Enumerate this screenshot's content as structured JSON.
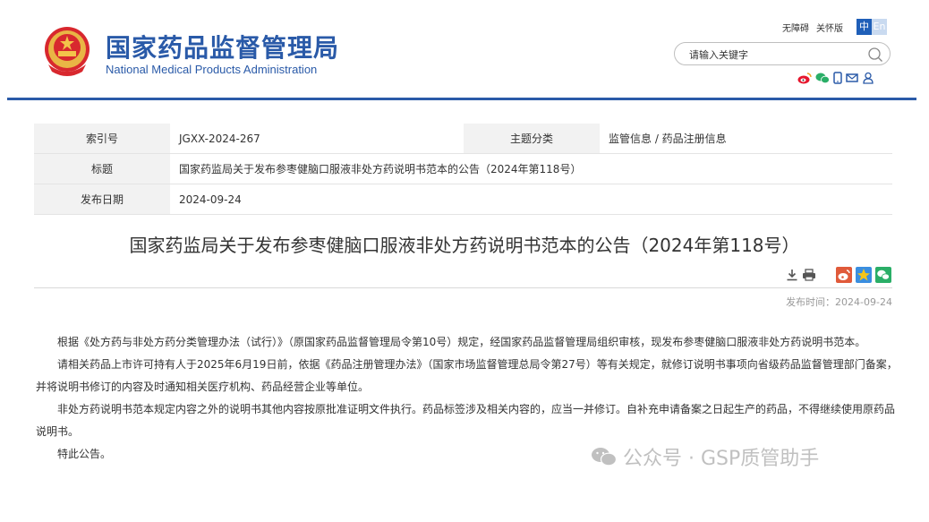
{
  "header": {
    "site_name_cn": "国家药品监督管理局",
    "site_name_en": "National Medical Products Administration",
    "accessibility_link": "无障碍",
    "care_mode_link": "关怀版",
    "lang_zh": "中",
    "lang_en": "En",
    "search_placeholder": "请输入关键字"
  },
  "meta": {
    "index_label": "索引号",
    "index_value": "JGXX-2024-267",
    "category_label": "主题分类",
    "category_value": "监管信息 / 药品注册信息",
    "title_label": "标题",
    "title_value": "国家药监局关于发布参枣健脑口服液非处方药说明书范本的公告（2024年第118号）",
    "date_label": "发布日期",
    "date_value": "2024-09-24"
  },
  "article": {
    "title": "国家药监局关于发布参枣健脑口服液非处方药说明书范本的公告（2024年第118号）",
    "pub_time": "发布时间：2024-09-24",
    "paragraphs": [
      "根据《处方药与非处方药分类管理办法（试行）》（原国家药品监督管理局令第10号）规定，经国家药品监督管理局组织审核，现发布参枣健脑口服液非处方药说明书范本。",
      "请相关药品上市许可持有人于2025年6月19日前，依据《药品注册管理办法》（国家市场监督管理总局令第27号）等有关规定，就修订说明书事项向省级药品监督管理部门备案，并将说明书修订的内容及时通知相关医疗机构、药品经营企业等单位。",
      "非处方药说明书范本规定内容之外的说明书其他内容按原批准证明文件执行。药品标签涉及相关内容的，应当一并修订。自补充申请备案之日起生产的药品，不得继续使用原药品说明书。",
      "特此公告。"
    ]
  },
  "watermark": "公众号 · GSP质管助手",
  "colors": {
    "brand": "#2a5aa8",
    "weibo": "#e6162d",
    "wechat": "#2aae67"
  }
}
